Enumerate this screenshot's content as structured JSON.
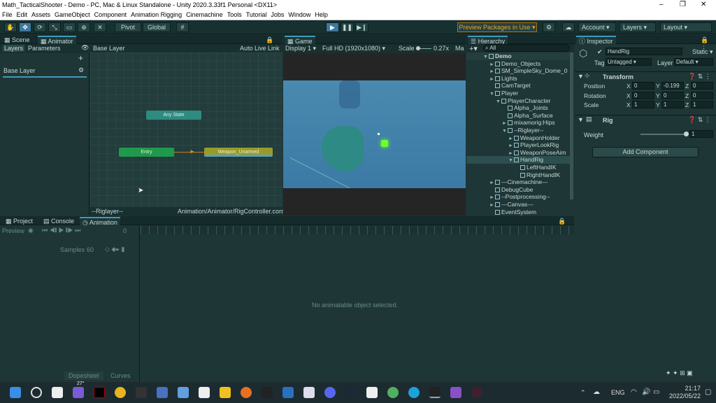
{
  "window": {
    "title": "Math_TacticalShooter - Demo - PC, Mac & Linux Standalone - Unity 2020.3.33f1 Personal <DX11>"
  },
  "menu": [
    "File",
    "Edit",
    "Assets",
    "GameObject",
    "Component",
    "Animation Rigging",
    "Cinemachine",
    "Tools",
    "Tutorial",
    "Jobs",
    "Window",
    "Help"
  ],
  "toolbar": {
    "pivot": "Pivot",
    "global": "Global",
    "preview_packages": "Preview Packages in Use ▾",
    "account": "Account",
    "layers": "Layers",
    "layout": "Layout"
  },
  "scene_panel": {
    "tabs": [
      "Scene",
      "Animator"
    ],
    "subtabs": [
      "Layers",
      "Parameters"
    ],
    "breadcrumb": "Base Layer",
    "auto_live_link": "Auto Live Link",
    "layer_item": "Base Layer",
    "nodes": {
      "any_state": "Any State",
      "entry": "Entry",
      "weapon_unarmed": "Weapon_Unarmed"
    },
    "footer_left": "--Riglayer--",
    "footer_right": "Animation/Animator/RigController.controller"
  },
  "game_panel": {
    "tab": "Game",
    "display": "Display 1",
    "resolution": "Full HD (1920x1080)",
    "scale_label": "Scale",
    "scale_value": "0.27x",
    "max": "Ma"
  },
  "hierarchy": {
    "tab": "Hierarchy",
    "search_placeholder": "All",
    "items": [
      {
        "label": "Demo",
        "indent": 0,
        "arrow": "▼",
        "scene": true
      },
      {
        "label": "Demo_Objects",
        "indent": 1,
        "arrow": "►"
      },
      {
        "label": "SM_SimpleSky_Dome_0",
        "indent": 1,
        "arrow": "►"
      },
      {
        "label": "Lights",
        "indent": 1,
        "arrow": "►"
      },
      {
        "label": "CamTarget",
        "indent": 1,
        "arrow": ""
      },
      {
        "label": "Player",
        "indent": 1,
        "arrow": "▼"
      },
      {
        "label": "PlayerCharacter",
        "indent": 2,
        "arrow": "▼"
      },
      {
        "label": "Alpha_Joints",
        "indent": 3,
        "arrow": ""
      },
      {
        "label": "Alpha_Surface",
        "indent": 3,
        "arrow": ""
      },
      {
        "label": "mixamorig:Hips",
        "indent": 3,
        "arrow": "►"
      },
      {
        "label": "--Riglayer--",
        "indent": 3,
        "arrow": "▼"
      },
      {
        "label": "WeaponHolder",
        "indent": 4,
        "arrow": "►"
      },
      {
        "label": "PlayerLookRig",
        "indent": 4,
        "arrow": "►"
      },
      {
        "label": "WeaponPoseAim",
        "indent": 4,
        "arrow": "►"
      },
      {
        "label": "HandRig",
        "indent": 4,
        "arrow": "▼",
        "selected": true
      },
      {
        "label": "LeftHandIK",
        "indent": 5,
        "arrow": ""
      },
      {
        "label": "RightHandIK",
        "indent": 5,
        "arrow": ""
      },
      {
        "label": "---Cinemachine---",
        "indent": 1,
        "arrow": "►"
      },
      {
        "label": "DebugCube",
        "indent": 1,
        "arrow": ""
      },
      {
        "label": "--Postprocessing--",
        "indent": 1,
        "arrow": "►"
      },
      {
        "label": "---Canvas---",
        "indent": 1,
        "arrow": "►"
      },
      {
        "label": "EventSystem",
        "indent": 1,
        "arrow": ""
      }
    ]
  },
  "inspector": {
    "tab": "Inspector",
    "name": "HandRig",
    "static": "Static",
    "tag_label": "Tag",
    "tag": "Untagged",
    "layer_label": "Layer",
    "layer": "Default",
    "transform": {
      "title": "Transform",
      "rows": [
        {
          "label": "Position",
          "x": "0",
          "y": "-0.199",
          "z": "0"
        },
        {
          "label": "Rotation",
          "x": "0",
          "y": "0",
          "z": "0"
        },
        {
          "label": "Scale",
          "x": "1",
          "y": "1",
          "z": "1"
        }
      ]
    },
    "rig": {
      "title": "Rig",
      "weight_label": "Weight",
      "weight": "1",
      "weight_fraction": 1.0
    },
    "add_component": "Add Component"
  },
  "bottom_panel": {
    "tabs": [
      "Project",
      "Console",
      "Animation"
    ],
    "preview": "Preview",
    "frame": "0",
    "samples_label": "Samples",
    "samples": "60",
    "empty": "No animatable object selected.",
    "dopesheet": "Dopesheet",
    "curves": "Curves"
  },
  "taskbar": {
    "time": "21:17",
    "date": "2022/05/22",
    "lang": "ENG",
    "weather": "27°"
  }
}
